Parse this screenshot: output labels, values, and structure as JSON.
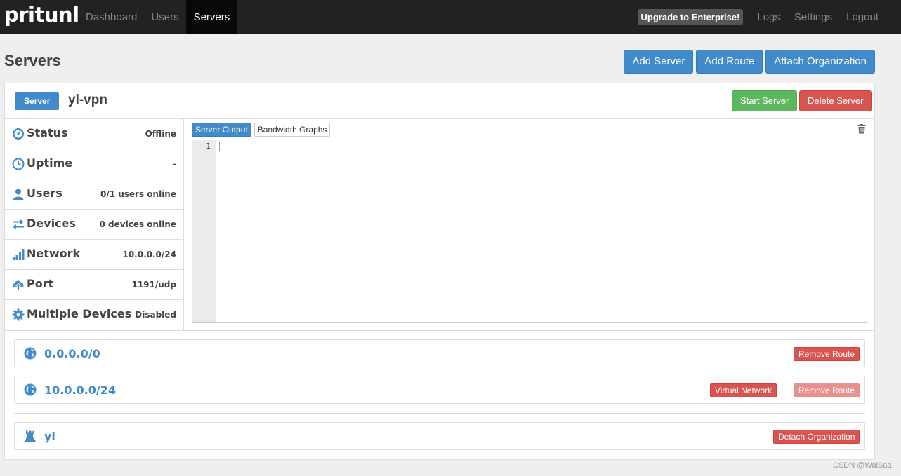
{
  "navbar": {
    "brand": "pritunl",
    "links": [
      "Dashboard",
      "Users",
      "Servers"
    ],
    "enterprise": "Upgrade to Enterprise!",
    "right_links": [
      "Logs",
      "Settings",
      "Logout"
    ]
  },
  "page": {
    "title": "Servers",
    "buttons": [
      "Add Server",
      "Add Route",
      "Attach Organization"
    ]
  },
  "server": {
    "label": "Server",
    "name": "yl-vpn",
    "start_label": "Start Server",
    "delete_label": "Delete Server",
    "stats": [
      {
        "label": "Status",
        "value": "Offline",
        "icon": "dashboard-icon"
      },
      {
        "label": "Uptime",
        "value": "-",
        "icon": "clock-icon"
      },
      {
        "label": "Users",
        "value": "0/1 users online",
        "icon": "user-icon"
      },
      {
        "label": "Devices",
        "value": "0 devices online",
        "icon": "transfer-icon"
      },
      {
        "label": "Network",
        "value": "10.0.0.0/24",
        "icon": "signal-icon"
      },
      {
        "label": "Port",
        "value": "1191/udp",
        "icon": "cloud-upload-icon"
      },
      {
        "label": "Multiple Devices",
        "value": "Disabled",
        "icon": "cog-icon"
      }
    ],
    "tabs": [
      "Server Output",
      "Bandwidth Graphs"
    ],
    "editor_line": "1"
  },
  "routes": [
    {
      "network": "0.0.0.0/0",
      "remove_label": "Remove Route"
    },
    {
      "network": "10.0.0.0/24",
      "virtual_label": "Virtual Network",
      "remove_label": "Remove Route"
    }
  ],
  "organization": {
    "name": "yl",
    "detach_label": "Detach Organization"
  },
  "watermark": "CSDN @WaiSaa",
  "colors": {
    "primary": "#428bca",
    "success": "#5cb85c",
    "danger": "#d9534f",
    "navbar": "#222222"
  }
}
